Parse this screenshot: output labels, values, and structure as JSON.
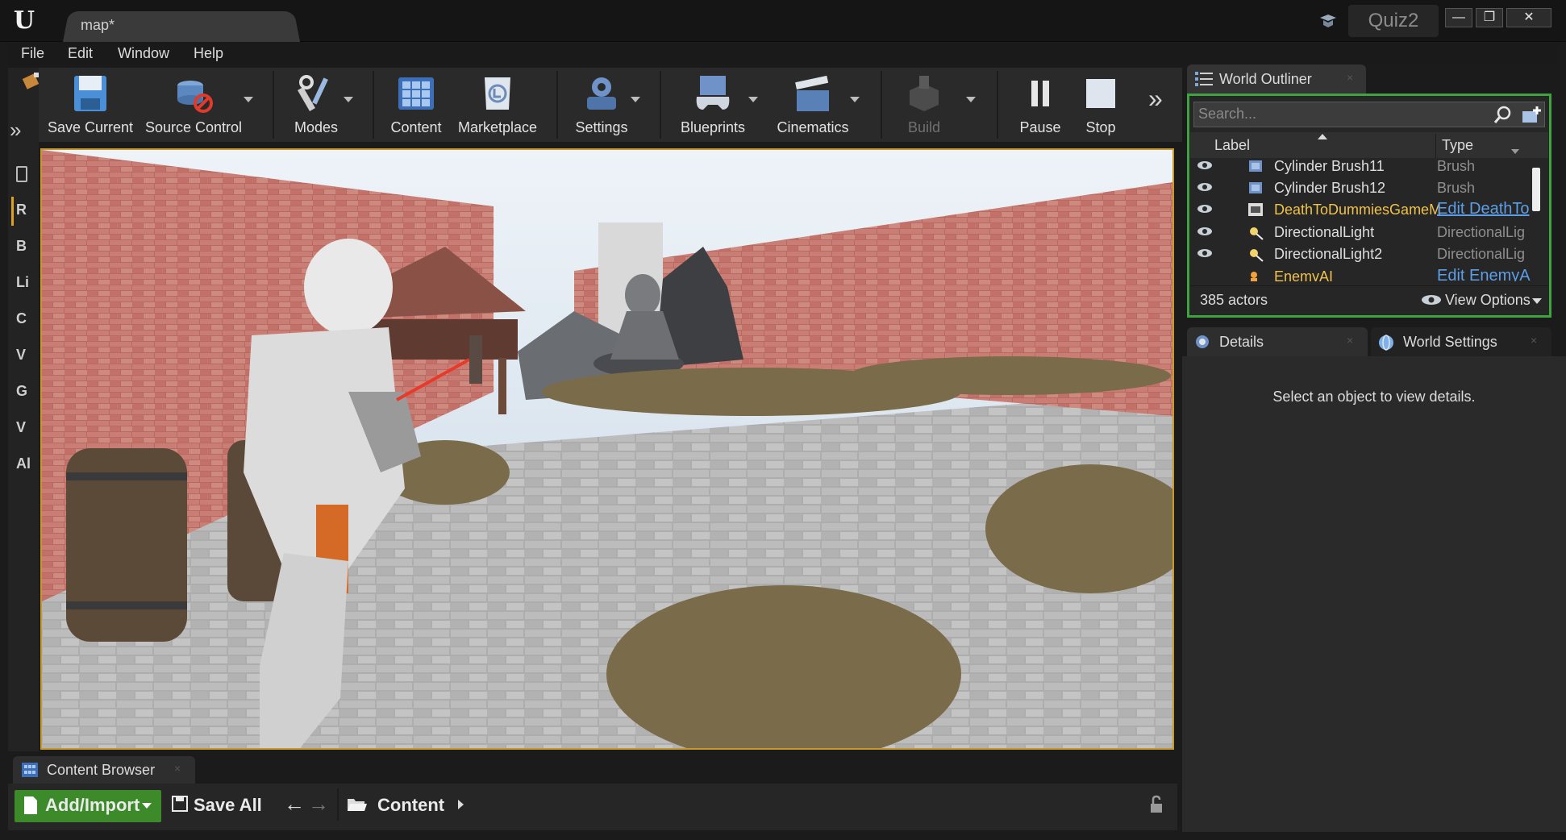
{
  "titlebar": {
    "logo": "U",
    "doc_tab": "map*",
    "project": "Quiz2",
    "minimize": "—",
    "restore": "❐",
    "close": "✕"
  },
  "menu": [
    "File",
    "Edit",
    "Window",
    "Help"
  ],
  "left_strip": [
    "R",
    "B",
    "Li",
    "C",
    "V",
    "G",
    "V",
    "Al"
  ],
  "toolbar": {
    "save_current": "Save Current",
    "source_control": "Source Control",
    "modes": "Modes",
    "content": "Content",
    "marketplace": "Marketplace",
    "settings": "Settings",
    "blueprints": "Blueprints",
    "cinematics": "Cinematics",
    "build": "Build",
    "pause": "Pause",
    "stop": "Stop",
    "more": "»"
  },
  "outliner": {
    "tab": "World Outliner",
    "search_placeholder": "Search...",
    "col_label": "Label",
    "col_type": "Type",
    "rows": [
      {
        "label": "Cylinder Brush11",
        "type": "Brush"
      },
      {
        "label": "Cylinder Brush12",
        "type": "Brush"
      },
      {
        "label": "DeathToDummiesGameM",
        "type": "Edit DeathTo"
      },
      {
        "label": "DirectionalLight",
        "type": "DirectionalLig"
      },
      {
        "label": "DirectionalLight2",
        "type": "DirectionalLig"
      },
      {
        "label": "EnemyAI",
        "type": "Edit EnemyA"
      }
    ],
    "count": "385 actors",
    "view_options": "View Options"
  },
  "details": {
    "tab": "Details",
    "world_settings_tab": "World Settings",
    "empty_message": "Select an object to view details."
  },
  "content_browser": {
    "tab": "Content Browser",
    "add_import": "Add/Import",
    "save_all": "Save All",
    "path": "Content"
  },
  "colors": {
    "viewport_border": "#c89a2e",
    "outliner_focus": "#3fa43f",
    "add_import_green": "#3d8a2a",
    "link_blue": "#5d9ee8",
    "blueprint_yellow": "#f0c24a"
  }
}
